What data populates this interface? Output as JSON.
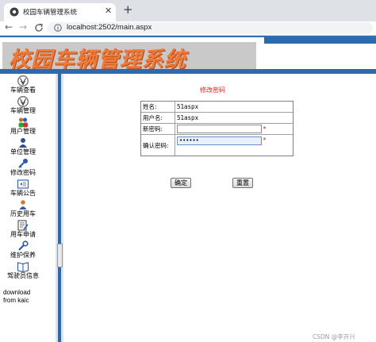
{
  "browser": {
    "tab_title": "校园车辆管理系统",
    "tab_close": "✕",
    "new_tab": "+",
    "back": "←",
    "forward": "→",
    "reload": "C",
    "url": "localhost:2502/main.aspx"
  },
  "banner": {
    "title": "校园车辆管理系统"
  },
  "sidebar": {
    "items": [
      {
        "label": "车辆查看",
        "icon": "vw-car-icon"
      },
      {
        "label": "车辆管理",
        "icon": "vw-car-icon"
      },
      {
        "label": "用户管理",
        "icon": "users-icon"
      },
      {
        "label": "单位管理",
        "icon": "unit-icon"
      },
      {
        "label": "修改密码",
        "icon": "key-icon"
      },
      {
        "label": "车辆公告",
        "icon": "announcement-icon"
      },
      {
        "label": "历史用车",
        "icon": "history-icon"
      },
      {
        "label": "用车申请",
        "icon": "request-icon"
      },
      {
        "label": "维护保养",
        "icon": "maintenance-icon"
      },
      {
        "label": "驾驶员信息",
        "icon": "book-icon"
      }
    ],
    "download_line1": "download",
    "download_line2": "from kaic"
  },
  "form": {
    "title": "修改密码",
    "rows": [
      {
        "label": "姓名:",
        "value": "51aspx"
      },
      {
        "label": "用户名:",
        "value": "51aspx"
      },
      {
        "label": "新密码:",
        "value": ""
      },
      {
        "label": "确认密码:",
        "value": "••••••"
      }
    ],
    "required_mark": "*",
    "confirm_button": "确定",
    "reset_button": "重置"
  },
  "watermark": "CSDN @李开兴",
  "colors": {
    "frame_blue": "#2e6aab",
    "banner_orange": "#f07a3c",
    "title_red": "#e02020"
  }
}
